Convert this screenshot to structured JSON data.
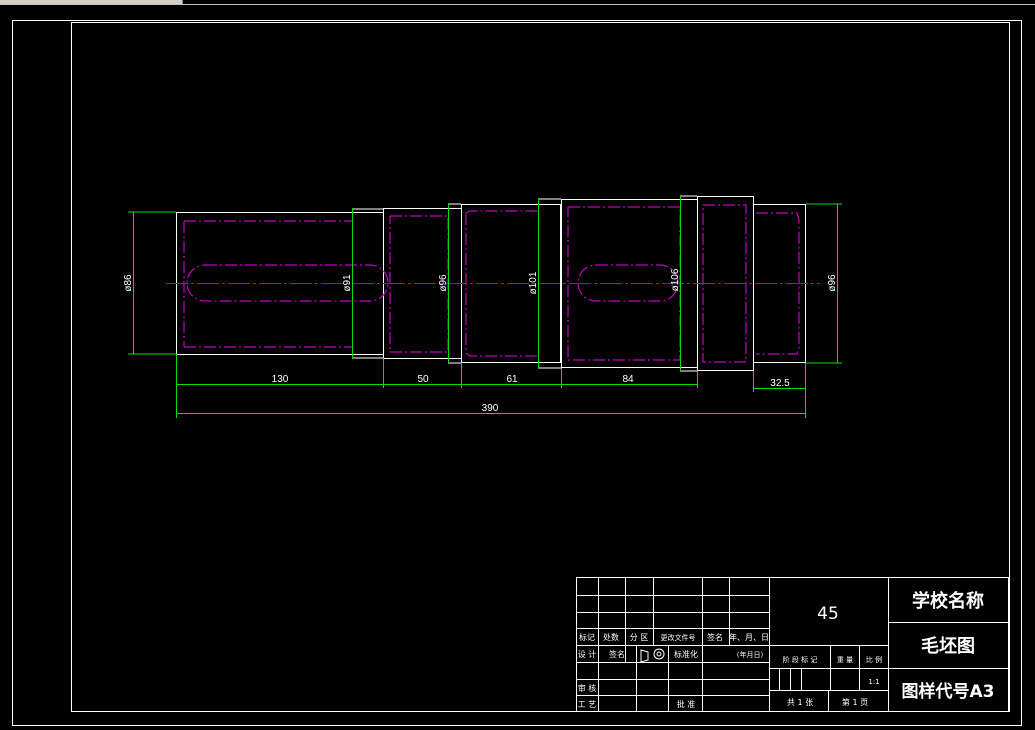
{
  "drawing": {
    "dimensions": {
      "dia_86": "ø86",
      "dia_91": "ø91",
      "dia_96_a": "ø96",
      "dia_101": "ø101",
      "dia_106": "ø106",
      "dia_96_b": "ø96",
      "len_130": "130",
      "len_50": "50",
      "len_61": "61",
      "len_84": "84",
      "len_32_5": "32.5",
      "len_390": "390"
    }
  },
  "title_block": {
    "material": "45",
    "school_name": "学校名称",
    "drawing_name": "毛坯图",
    "drawing_code": "图样代号A3",
    "row_marks": [
      "标记",
      "处数",
      "分 区",
      "更改文件号",
      "签名",
      "年、月、日"
    ],
    "design": "设 计",
    "signature": "签名",
    "standardization": "标准化",
    "date_note": "(年月日)",
    "stage_mark": "阶 段 标 记",
    "weight": "重 量",
    "scale": "比 例",
    "scale_value": "1:1",
    "review": "审 核",
    "process": "工 艺",
    "approve": "批 准",
    "sheets_total": "共 1 张",
    "sheet_no": "第 1 页"
  },
  "colors": {
    "outline": "#ffffff",
    "dimension": "#00e000",
    "hidden": "#c000c0",
    "centerline": "#e00000"
  }
}
